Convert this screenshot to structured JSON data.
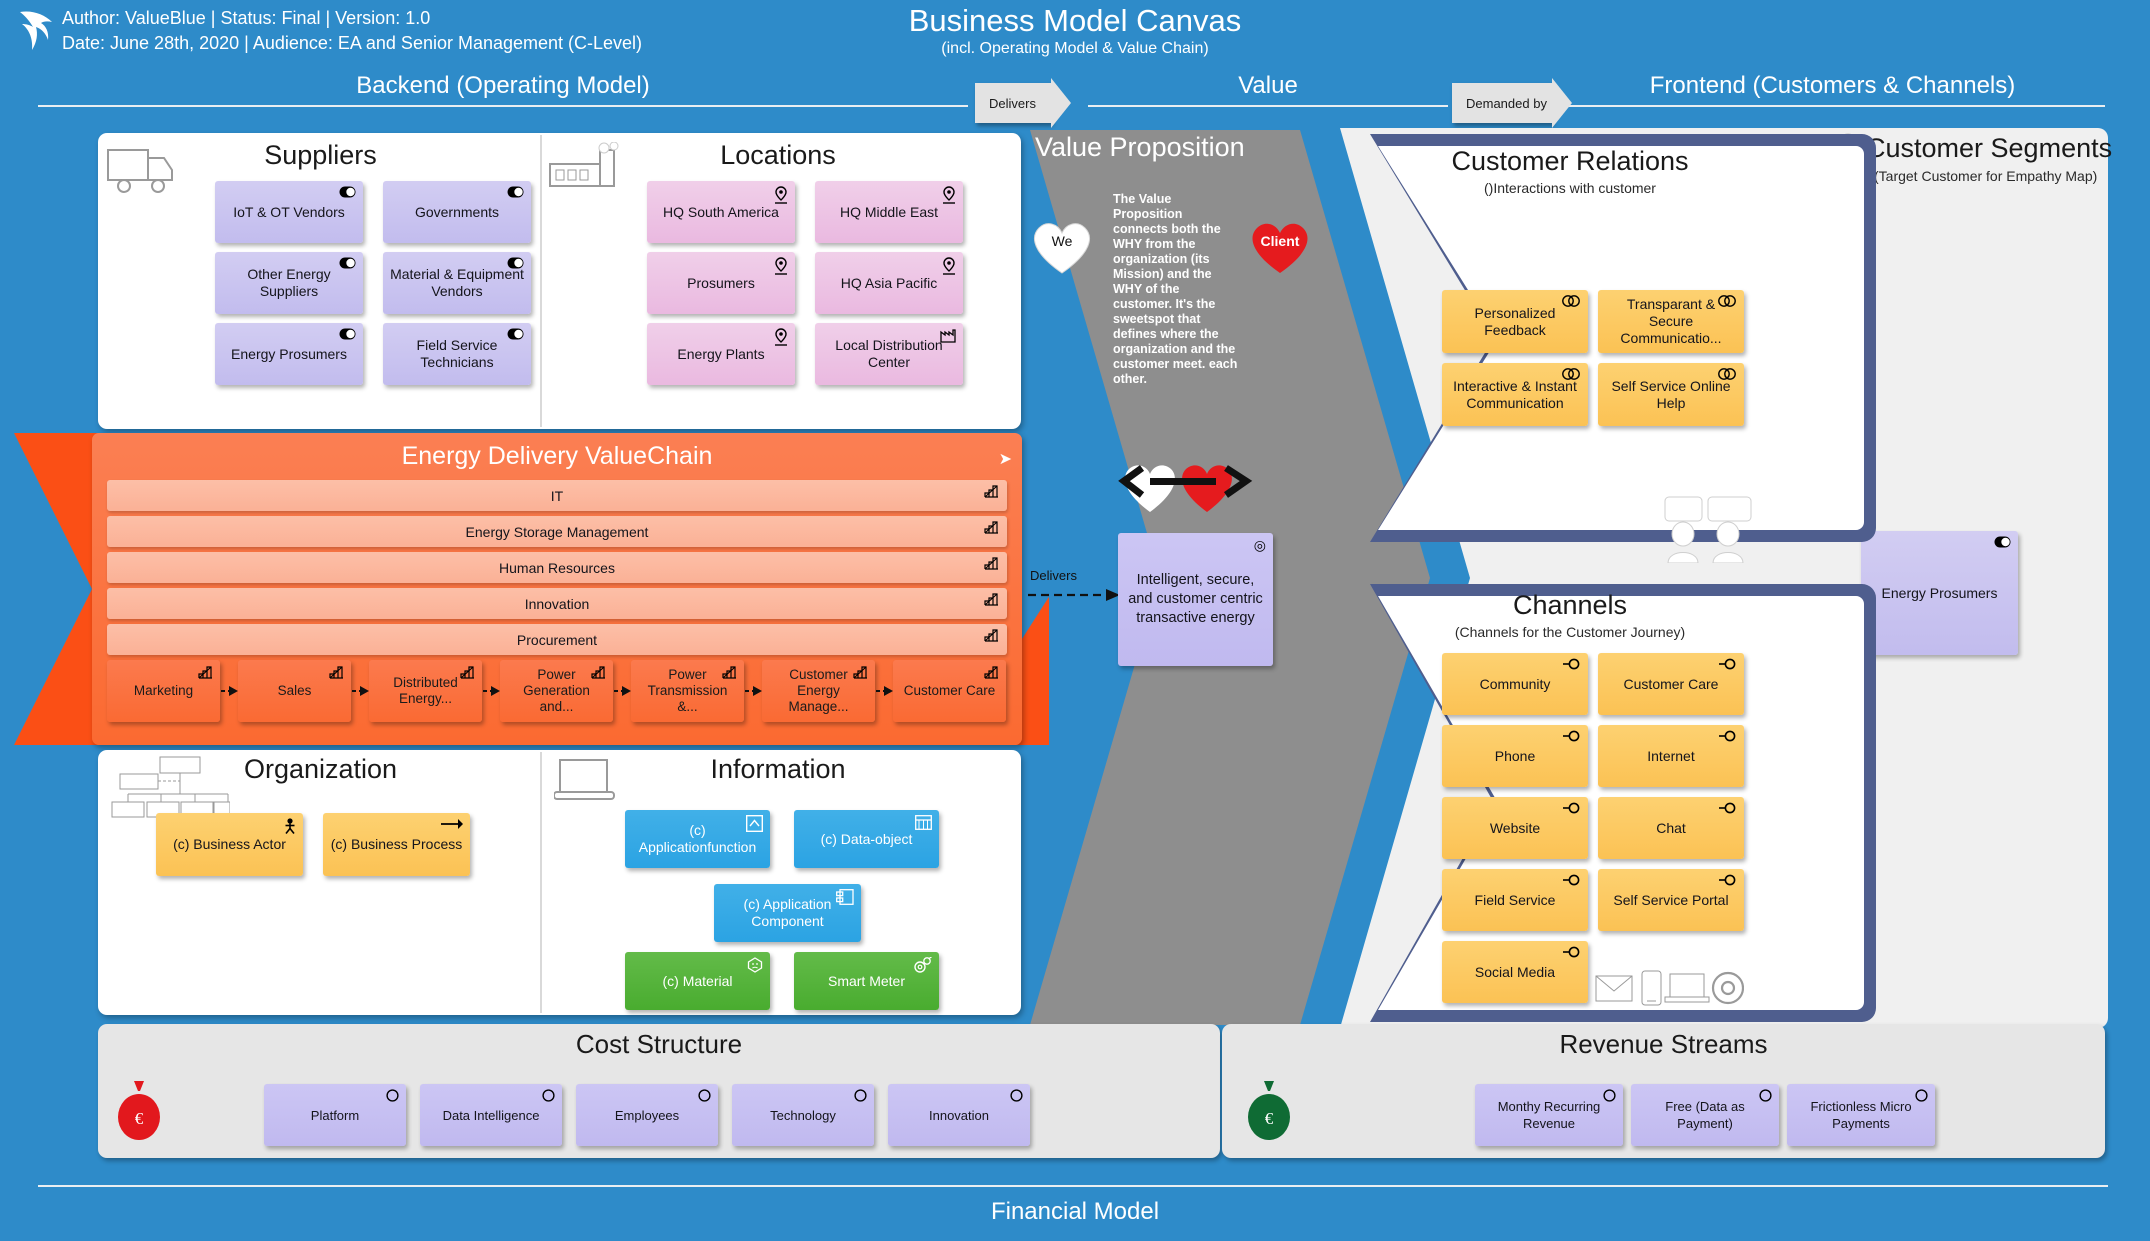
{
  "header": {
    "meta_line1": "Author: ValueBlue  |  Status: Final  |  Version: 1.0",
    "meta_line2": "Date: June 28th, 2020  |  Audience: EA and Senior Management (C-Level)",
    "title": "Business Model Canvas",
    "subtitle": "(incl. Operating Model & Value Chain)",
    "logo_icon": "dolphin-logo-icon"
  },
  "bands": {
    "backend": "Backend (Operating Model)",
    "value": "Value",
    "frontend": "Frontend (Customers & Channels)",
    "delivers_tag": "Delivers",
    "demanded_tag": "Demanded by"
  },
  "footer": {
    "label": "Financial Model"
  },
  "suppliers": {
    "title": "Suppliers",
    "icon": "delivery-truck-icon",
    "items": [
      {
        "label": "IoT & OT Vendors",
        "icon": "toggle-icon"
      },
      {
        "label": "Governments",
        "icon": "toggle-icon"
      },
      {
        "label": "Other Energy Suppliers",
        "icon": "toggle-icon"
      },
      {
        "label": "Material & Equipment Vendors",
        "icon": "toggle-icon"
      },
      {
        "label": "Energy Prosumers",
        "icon": "toggle-icon"
      },
      {
        "label": "Field Service Technicians",
        "icon": "toggle-icon"
      }
    ]
  },
  "locations": {
    "title": "Locations",
    "icon": "factory-icon",
    "items": [
      {
        "label": "HQ South America",
        "icon": "map-pin-icon"
      },
      {
        "label": "HQ Middle East",
        "icon": "map-pin-icon"
      },
      {
        "label": "Prosumers",
        "icon": "map-pin-icon"
      },
      {
        "label": "HQ Asia Pacific",
        "icon": "map-pin-icon"
      },
      {
        "label": "Energy Plants",
        "icon": "map-pin-icon"
      },
      {
        "label": "Local Distribution Center",
        "icon": "facility-icon"
      }
    ]
  },
  "value_proposition": {
    "title": "Value Proposition",
    "description": "The Value Proposition connects both the WHY from the organization (its Mission) and the WHY of the customer. It's the sweetspot that defines where the organization and the customer meet. each other.",
    "we_heart": "We",
    "client_heart": "Client",
    "delivers_link": "Delivers",
    "statement": "Intelligent, secure, and customer centric transactive energy",
    "statement_icon": "goal-target-icon",
    "hearts_icon": "two-hearts-double-arrow-icon"
  },
  "customer_relations": {
    "title": "Customer Relations",
    "subtitle": "()Interactions with customer",
    "decor_icon": "two-people-talking-icon",
    "items": [
      {
        "label": "Personalized Feedback",
        "icon": "interaction-icon"
      },
      {
        "label": "Transparant & Secure Communicatio...",
        "icon": "interaction-icon"
      },
      {
        "label": "Interactive & Instant Communication",
        "icon": "interaction-icon"
      },
      {
        "label": "Self Service Online Help",
        "icon": "interaction-icon"
      }
    ]
  },
  "customer_segments": {
    "title": "Customer Segments",
    "subtitle": "(Target Customer for Empathy Map)",
    "icon": "person-avatar-icon",
    "items": [
      {
        "label": "Energy Prosumers",
        "icon": "toggle-icon"
      }
    ]
  },
  "channels": {
    "title": "Channels",
    "subtitle": "(Channels for the Customer Journey)",
    "decor_icons": [
      "envelope-icon",
      "smartphone-icon",
      "laptop-icon",
      "at-sign-icon"
    ],
    "items": [
      {
        "label": "Community",
        "icon": "service-interface-icon"
      },
      {
        "label": "Customer Care",
        "icon": "service-interface-icon"
      },
      {
        "label": "Phone",
        "icon": "service-interface-icon"
      },
      {
        "label": "Internet",
        "icon": "service-interface-icon"
      },
      {
        "label": "Website",
        "icon": "service-interface-icon"
      },
      {
        "label": "Chat",
        "icon": "service-interface-icon"
      },
      {
        "label": "Field Service",
        "icon": "service-interface-icon"
      },
      {
        "label": "Self Service Portal",
        "icon": "service-interface-icon"
      },
      {
        "label": "Social Media",
        "icon": "service-interface-icon"
      }
    ]
  },
  "valuechain": {
    "title": "Energy Delivery ValueChain",
    "corner_icon": "valuechain-icon",
    "support_rows": [
      {
        "label": "IT",
        "icon": "valuestream-icon"
      },
      {
        "label": "Energy Storage Management",
        "icon": "valuestream-icon"
      },
      {
        "label": "Human Resources",
        "icon": "valuestream-icon"
      },
      {
        "label": "Innovation",
        "icon": "valuestream-icon"
      },
      {
        "label": "Procurement",
        "icon": "valuestream-icon"
      }
    ],
    "stages": [
      {
        "label": "Marketing",
        "icon": "valuestream-icon"
      },
      {
        "label": "Sales",
        "icon": "valuestream-icon"
      },
      {
        "label": "Distributed Energy...",
        "icon": "valuestream-icon"
      },
      {
        "label": "Power Generation and...",
        "icon": "valuestream-icon"
      },
      {
        "label": "Power Transmission &...",
        "icon": "valuestream-icon"
      },
      {
        "label": "Customer Energy Manage...",
        "icon": "valuestream-icon"
      },
      {
        "label": "Customer Care",
        "icon": "valuestream-icon"
      }
    ]
  },
  "organization": {
    "title": "Organization",
    "icon": "org-chart-icon",
    "items": [
      {
        "label": "(c) Business Actor",
        "icon": "business-actor-icon"
      },
      {
        "label": "(c) Business Process",
        "icon": "process-arrow-icon"
      }
    ]
  },
  "information": {
    "title": "Information",
    "icon": "laptop-icon",
    "items": [
      {
        "label": "(c) Applicationfunction",
        "icon": "application-function-icon",
        "color": "blue"
      },
      {
        "label": "(c) Data-object",
        "icon": "data-object-icon",
        "color": "blue"
      },
      {
        "label": "(c) Application Component",
        "icon": "application-component-icon",
        "color": "blue"
      },
      {
        "label": "(c) Material",
        "icon": "material-icon",
        "color": "green"
      },
      {
        "label": "Smart Meter",
        "icon": "equipment-icon",
        "color": "green"
      }
    ]
  },
  "cost_structure": {
    "title": "Cost Structure",
    "icon": "red-money-bag-icon",
    "items": [
      {
        "label": "Platform",
        "icon": "circle-icon"
      },
      {
        "label": "Data Intelligence",
        "icon": "circle-icon"
      },
      {
        "label": "Employees",
        "icon": "circle-icon"
      },
      {
        "label": "Technology",
        "icon": "circle-icon"
      },
      {
        "label": "Innovation",
        "icon": "circle-icon"
      }
    ]
  },
  "revenue_streams": {
    "title": "Revenue Streams",
    "icon": "green-money-bag-icon",
    "items": [
      {
        "label": "Monthy Recurring Revenue",
        "icon": "circle-icon"
      },
      {
        "label": "Free (Data as Payment)",
        "icon": "circle-icon"
      },
      {
        "label": "Frictionless Micro Payments",
        "icon": "circle-icon"
      }
    ]
  },
  "colors": {
    "canvas_blue": "#2e8bc9",
    "valuechain_orange": "#fb6a31",
    "chevron_navy": "#4f5e8e",
    "value_gray": "#8e8e8e",
    "segment_gray": "#f0f0f0",
    "cost_gray": "#e6e6e6"
  }
}
